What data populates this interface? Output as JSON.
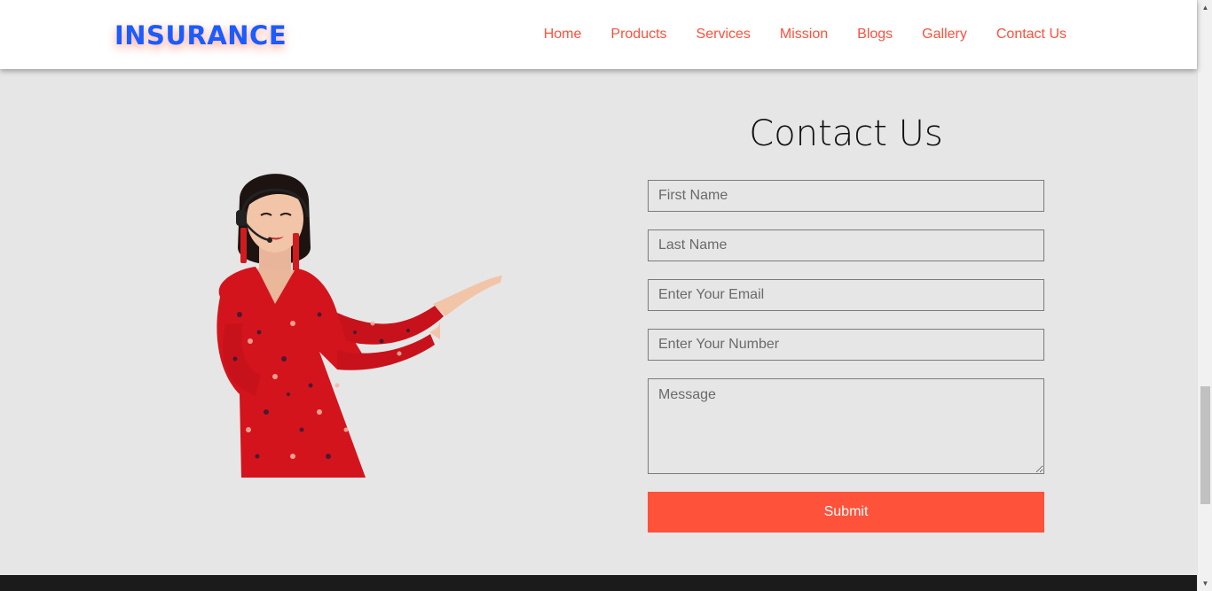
{
  "header": {
    "brand": "INSURANCE",
    "nav": [
      "Home",
      "Products",
      "Services",
      "Mission",
      "Blogs",
      "Gallery",
      "Contact Us"
    ]
  },
  "contact": {
    "title": "Contact Us",
    "fields": {
      "first_name_placeholder": "First Name",
      "last_name_placeholder": "Last Name",
      "email_placeholder": "Enter Your Email",
      "number_placeholder": "Enter Your Number",
      "message_placeholder": "Message"
    },
    "submit_label": "Submit"
  },
  "colors": {
    "brand": "#1a5cff",
    "accent": "#ff523b",
    "nav_link": "#ff4f3a",
    "section_bg": "#e6e6e6",
    "footer_bg": "#1b1b1b"
  },
  "icons": {
    "scroll_up": "chevron-up-icon",
    "scroll_down": "chevron-down-icon"
  }
}
